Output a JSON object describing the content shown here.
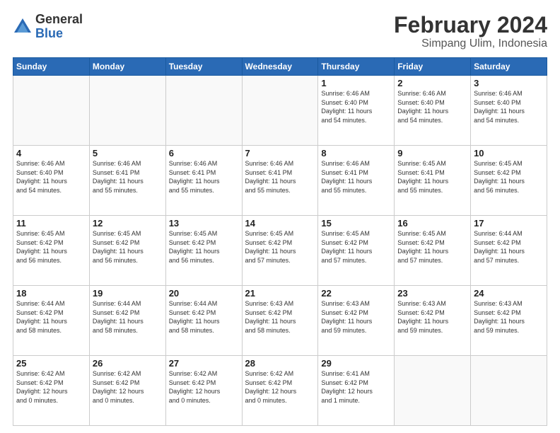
{
  "logo": {
    "general": "General",
    "blue": "Blue"
  },
  "title": "February 2024",
  "subtitle": "Simpang Ulim, Indonesia",
  "days_header": [
    "Sunday",
    "Monday",
    "Tuesday",
    "Wednesday",
    "Thursday",
    "Friday",
    "Saturday"
  ],
  "weeks": [
    [
      {
        "day": "",
        "info": ""
      },
      {
        "day": "",
        "info": ""
      },
      {
        "day": "",
        "info": ""
      },
      {
        "day": "",
        "info": ""
      },
      {
        "day": "1",
        "info": "Sunrise: 6:46 AM\nSunset: 6:40 PM\nDaylight: 11 hours\nand 54 minutes."
      },
      {
        "day": "2",
        "info": "Sunrise: 6:46 AM\nSunset: 6:40 PM\nDaylight: 11 hours\nand 54 minutes."
      },
      {
        "day": "3",
        "info": "Sunrise: 6:46 AM\nSunset: 6:40 PM\nDaylight: 11 hours\nand 54 minutes."
      }
    ],
    [
      {
        "day": "4",
        "info": "Sunrise: 6:46 AM\nSunset: 6:40 PM\nDaylight: 11 hours\nand 54 minutes."
      },
      {
        "day": "5",
        "info": "Sunrise: 6:46 AM\nSunset: 6:41 PM\nDaylight: 11 hours\nand 55 minutes."
      },
      {
        "day": "6",
        "info": "Sunrise: 6:46 AM\nSunset: 6:41 PM\nDaylight: 11 hours\nand 55 minutes."
      },
      {
        "day": "7",
        "info": "Sunrise: 6:46 AM\nSunset: 6:41 PM\nDaylight: 11 hours\nand 55 minutes."
      },
      {
        "day": "8",
        "info": "Sunrise: 6:46 AM\nSunset: 6:41 PM\nDaylight: 11 hours\nand 55 minutes."
      },
      {
        "day": "9",
        "info": "Sunrise: 6:45 AM\nSunset: 6:41 PM\nDaylight: 11 hours\nand 55 minutes."
      },
      {
        "day": "10",
        "info": "Sunrise: 6:45 AM\nSunset: 6:42 PM\nDaylight: 11 hours\nand 56 minutes."
      }
    ],
    [
      {
        "day": "11",
        "info": "Sunrise: 6:45 AM\nSunset: 6:42 PM\nDaylight: 11 hours\nand 56 minutes."
      },
      {
        "day": "12",
        "info": "Sunrise: 6:45 AM\nSunset: 6:42 PM\nDaylight: 11 hours\nand 56 minutes."
      },
      {
        "day": "13",
        "info": "Sunrise: 6:45 AM\nSunset: 6:42 PM\nDaylight: 11 hours\nand 56 minutes."
      },
      {
        "day": "14",
        "info": "Sunrise: 6:45 AM\nSunset: 6:42 PM\nDaylight: 11 hours\nand 57 minutes."
      },
      {
        "day": "15",
        "info": "Sunrise: 6:45 AM\nSunset: 6:42 PM\nDaylight: 11 hours\nand 57 minutes."
      },
      {
        "day": "16",
        "info": "Sunrise: 6:45 AM\nSunset: 6:42 PM\nDaylight: 11 hours\nand 57 minutes."
      },
      {
        "day": "17",
        "info": "Sunrise: 6:44 AM\nSunset: 6:42 PM\nDaylight: 11 hours\nand 57 minutes."
      }
    ],
    [
      {
        "day": "18",
        "info": "Sunrise: 6:44 AM\nSunset: 6:42 PM\nDaylight: 11 hours\nand 58 minutes."
      },
      {
        "day": "19",
        "info": "Sunrise: 6:44 AM\nSunset: 6:42 PM\nDaylight: 11 hours\nand 58 minutes."
      },
      {
        "day": "20",
        "info": "Sunrise: 6:44 AM\nSunset: 6:42 PM\nDaylight: 11 hours\nand 58 minutes."
      },
      {
        "day": "21",
        "info": "Sunrise: 6:43 AM\nSunset: 6:42 PM\nDaylight: 11 hours\nand 58 minutes."
      },
      {
        "day": "22",
        "info": "Sunrise: 6:43 AM\nSunset: 6:42 PM\nDaylight: 11 hours\nand 59 minutes."
      },
      {
        "day": "23",
        "info": "Sunrise: 6:43 AM\nSunset: 6:42 PM\nDaylight: 11 hours\nand 59 minutes."
      },
      {
        "day": "24",
        "info": "Sunrise: 6:43 AM\nSunset: 6:42 PM\nDaylight: 11 hours\nand 59 minutes."
      }
    ],
    [
      {
        "day": "25",
        "info": "Sunrise: 6:42 AM\nSunset: 6:42 PM\nDaylight: 12 hours\nand 0 minutes."
      },
      {
        "day": "26",
        "info": "Sunrise: 6:42 AM\nSunset: 6:42 PM\nDaylight: 12 hours\nand 0 minutes."
      },
      {
        "day": "27",
        "info": "Sunrise: 6:42 AM\nSunset: 6:42 PM\nDaylight: 12 hours\nand 0 minutes."
      },
      {
        "day": "28",
        "info": "Sunrise: 6:42 AM\nSunset: 6:42 PM\nDaylight: 12 hours\nand 0 minutes."
      },
      {
        "day": "29",
        "info": "Sunrise: 6:41 AM\nSunset: 6:42 PM\nDaylight: 12 hours\nand 1 minute."
      },
      {
        "day": "",
        "info": ""
      },
      {
        "day": "",
        "info": ""
      }
    ]
  ]
}
